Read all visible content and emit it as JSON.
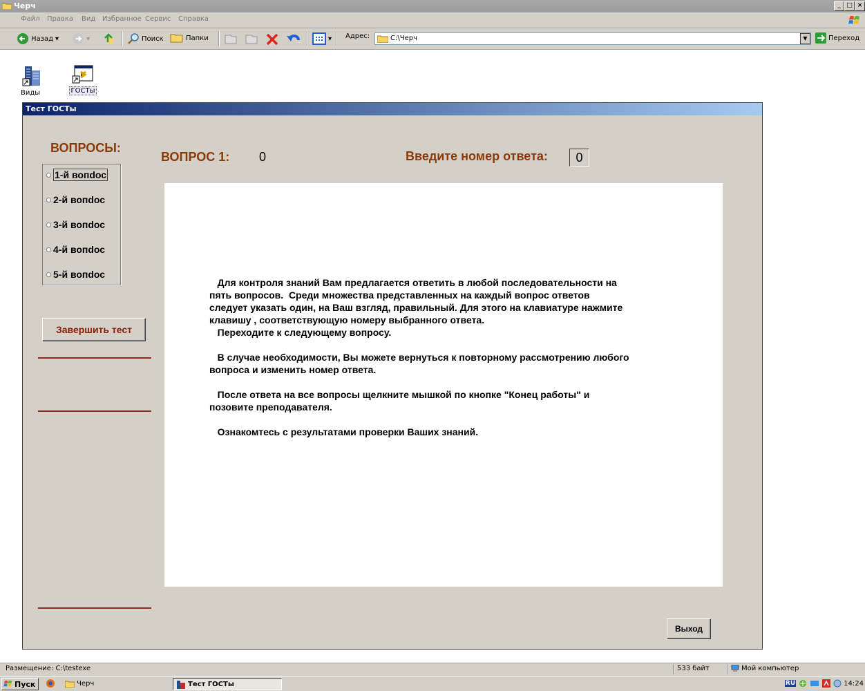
{
  "window": {
    "title": "Черч",
    "menu": [
      "Файл",
      "Правка",
      "Вид",
      "Избранное",
      "Сервис",
      "Справка"
    ],
    "toolbar": {
      "back_label": "Назад",
      "search_label": "Поиск",
      "folders_label": "Папки",
      "address_label": "Адрес:",
      "address_value": "C:\\Черч",
      "go_label": "Переход"
    }
  },
  "desktop_icons": [
    {
      "label": "Виды",
      "icon": "buildings-shortcut-icon"
    },
    {
      "label": "ГОСТы",
      "icon": "program-shortcut-icon"
    }
  ],
  "dialog": {
    "title": "Тест ГОСТы",
    "questions_heading": "ВОПРОСЫ:",
    "question_label": "ВОПРОС 1:",
    "question_value": "0",
    "answer_prompt": "Введите номер ответа:",
    "answer_value": "0",
    "questions": [
      {
        "label": "1-й вопdос",
        "selected": true
      },
      {
        "label": "2-й вопdос",
        "selected": false
      },
      {
        "label": "3-й вопdос",
        "selected": false
      },
      {
        "label": "4-й вопdос",
        "selected": false
      },
      {
        "label": "5-й вопdос",
        "selected": false
      }
    ],
    "finish_label": "Завершить тест",
    "exit_label": "Выход",
    "instructions": "   Для контроля знаний Вам предлагается ответить в любой последовательности на\nпять вопросов.  Среди множества представленных на каждый вопрос ответов\nследует указать один, на Ваш взгляд, правильный. Для этого на клавиатуре нажмите\nклавишу , соответствующую номеру выбранного ответа.\n   Переходите к следующему вопросу.\n\n   В случае необходимости, Вы можете вернуться к повторному рассмотрению любого\nвопроса и изменить номер ответа.\n\n   После ответа на все вопросы щелкните мышкой по кнопке \"Конец работы\" и\nпозовите преподавателя.\n\n   Ознакомтесь с результатами проверки Ваших знаний.",
    "accent_color": "#8b3a05"
  },
  "statusbar": {
    "location": "Размещение: C:\\testexe",
    "size": "533 байт",
    "zone": "Мой компьютер"
  },
  "taskbar": {
    "start_label": "Пуск",
    "items": [
      "Черч",
      "Тест ГОСТы"
    ],
    "tray_lang": "RU",
    "clock": "14:24"
  }
}
